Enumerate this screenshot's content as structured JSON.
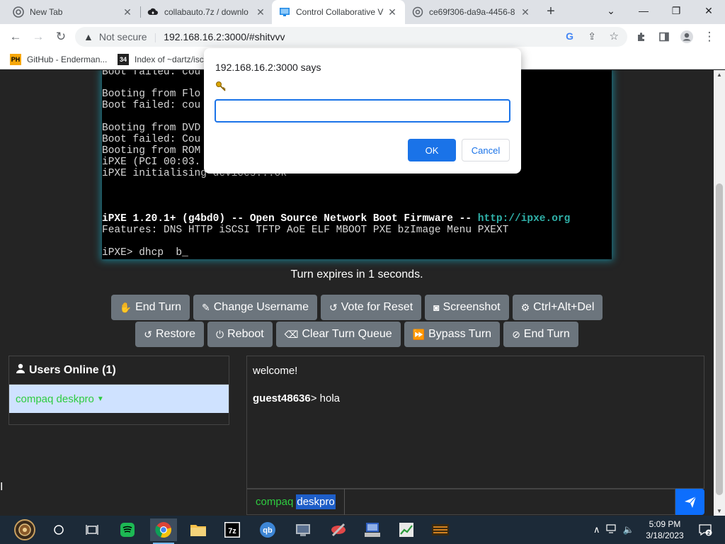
{
  "browser": {
    "tabs": [
      {
        "title": "New Tab",
        "icon": "chrome-icon"
      },
      {
        "title": "collabauto.7z / downlo",
        "icon": "cloud-upload-icon"
      },
      {
        "title": "Control Collaborative V",
        "icon": "monitor-icon"
      },
      {
        "title": "ce69f306-da9a-4456-8",
        "icon": "globe-icon"
      }
    ],
    "address": {
      "security": "Not secure",
      "url": "192.168.16.2:3000/#shitvvv"
    },
    "bookmarks": [
      {
        "label": "GitHub - Enderman...",
        "icon_text": "PH"
      },
      {
        "label": "Index of ~dartz/isc",
        "icon_text": "34"
      }
    ]
  },
  "dialog": {
    "origin": "192.168.16.2:3000 says",
    "message_icon": "key-icon",
    "input_value": "",
    "ok_label": "OK",
    "cancel_label": "Cancel"
  },
  "vm_screen": {
    "lines": [
      "Boot failed: cou",
      "Booting from Flo",
      "Boot failed: cou",
      "",
      "Booting from DVD",
      "Boot failed: Cou",
      "Booting from ROM",
      "iPXE (PCI 00:03.",
      "iPXE initialising devices...ok",
      "",
      "",
      "",
      "iPXE 1.20.1+ (g4bd0) -- Open Source Network Boot Firmware --",
      "Features: DNS HTTP iSCSI TFTP AoE ELF MBOOT PXE bzImage Menu PXEXT",
      "",
      "iPXE> dhcp  b_"
    ],
    "ipxe_url": "http://ipxe.org"
  },
  "turn_text": "Turn expires in 1 seconds.",
  "buttons_row1": [
    {
      "label": "End Turn",
      "icon": "hand-icon"
    },
    {
      "label": "Change Username",
      "icon": "user-edit-icon"
    },
    {
      "label": "Vote for Reset",
      "icon": "undo-icon"
    },
    {
      "label": "Screenshot",
      "icon": "camera-icon"
    },
    {
      "label": "Ctrl+Alt+Del",
      "icon": "gear-icon"
    }
  ],
  "buttons_row2": [
    {
      "label": "Restore",
      "icon": "undo-icon"
    },
    {
      "label": "Reboot",
      "icon": "power-icon"
    },
    {
      "label": "Clear Turn Queue",
      "icon": "eraser-icon"
    },
    {
      "label": "Bypass Turn",
      "icon": "fast-forward-icon"
    },
    {
      "label": "End Turn",
      "icon": "ban-icon"
    }
  ],
  "users": {
    "title": "Users Online (1)",
    "list": [
      {
        "name": "compaq deskpro"
      }
    ]
  },
  "chat": {
    "messages": [
      {
        "author": "",
        "text": "welcome!"
      },
      {
        "author": "guest48636",
        "text": "> hola"
      }
    ],
    "input_name_part1": "compaq",
    "input_name_part2": "deskpro",
    "input_value": ""
  },
  "taskbar": {
    "clock_time": "5:09 PM",
    "clock_date": "3/18/2023",
    "apps": [
      "start",
      "search",
      "task-view",
      "spotify",
      "chrome",
      "file-explorer",
      "7zip",
      "qbittorrent",
      "app-1",
      "app-2",
      "app-3",
      "app-4",
      "app-5"
    ]
  }
}
